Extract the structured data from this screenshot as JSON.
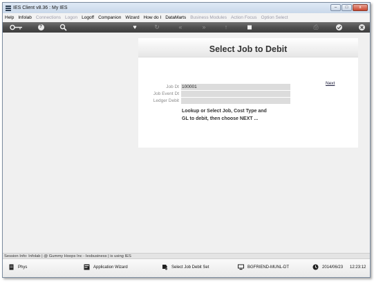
{
  "window": {
    "title": "IES Client v8.36 : My IES",
    "controls": {
      "minimize": "–",
      "restore": "□",
      "close": "x"
    }
  },
  "menu": {
    "items": [
      {
        "label": "Help",
        "enabled": true
      },
      {
        "label": "Infolab",
        "enabled": true
      },
      {
        "label": "Connections",
        "enabled": false
      },
      {
        "label": "Logon",
        "enabled": false
      },
      {
        "label": "Logoff",
        "enabled": true
      },
      {
        "label": "Companion",
        "enabled": true
      },
      {
        "label": "Wizard",
        "enabled": true
      },
      {
        "label": "How do I",
        "enabled": true
      },
      {
        "label": "DataMarts",
        "enabled": true
      },
      {
        "label": "Business Modules",
        "enabled": false
      },
      {
        "label": "Action Focus",
        "enabled": false
      },
      {
        "label": "Option Select",
        "enabled": false
      }
    ]
  },
  "toolbar": {
    "icons": [
      "key-icon",
      "help-icon",
      "search-icon",
      "heart-icon",
      "refresh-icon",
      "rewind-icon",
      "forward-icon",
      "upload-icon",
      "stop-icon",
      "print-icon",
      "check-icon",
      "close-icon"
    ]
  },
  "panel": {
    "title": "Select Job to Debit",
    "fields": {
      "job_dt": {
        "label": "Job Dt",
        "value": "100001"
      },
      "job_event_dt": {
        "label": "Job Event Dt",
        "value": ""
      },
      "ledger_debit": {
        "label": "Ledger Debit",
        "value": ""
      }
    },
    "next_label": "Next",
    "instructions": "Lookup or Select Job, Cost Type and\nGL to debit, then choose NEXT ..."
  },
  "session": {
    "info": "Session Info: Infolab | @ Gummy Hoops Inc  - Iesbusiness | is using IES"
  },
  "status": {
    "phys": "Phys",
    "wizard": "Application Wizard",
    "current_step": "Select Job Debit Set",
    "machine": "BGFRIEND-MUNL-DT",
    "date": "2014/06/23",
    "time": "12:23:12"
  }
}
